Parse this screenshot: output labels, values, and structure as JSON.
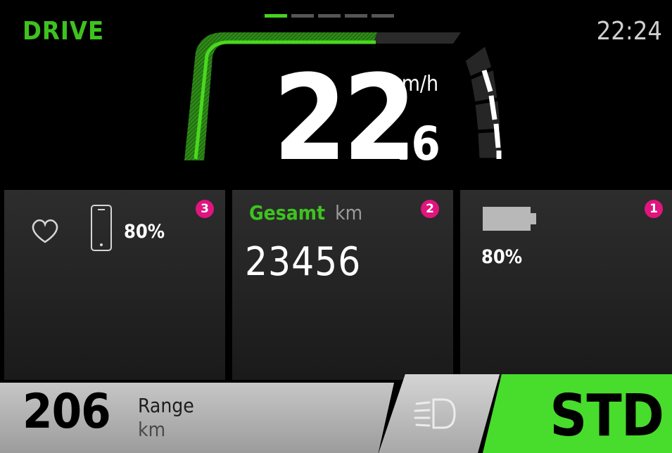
{
  "status": {
    "mode": "DRIVE",
    "time": "22:24",
    "active_page": 1,
    "page_count": 5
  },
  "speed": {
    "integer": "22",
    "decimal": ".6",
    "unit": "km/h",
    "value": 22.6
  },
  "widgets": {
    "left": {
      "badge": "3",
      "heart_icon": "heart-icon",
      "phone_icon": "smartphone-icon",
      "phone_battery": "80%"
    },
    "center": {
      "badge": "2",
      "label": "Gesamt",
      "unit": "km",
      "value": "23456"
    },
    "right": {
      "badge": "1",
      "battery_icon": "battery-icon",
      "battery_level": "80%"
    }
  },
  "bottom": {
    "range_value": "206",
    "range_label": "Range",
    "range_unit": "km",
    "light_icon": "headlight-icon",
    "assist_mode": "STD"
  },
  "colors": {
    "accent_green": "#3ec21f",
    "mode_green": "#48dc2c",
    "badge_pink": "#e0157e",
    "background": "#000000"
  }
}
